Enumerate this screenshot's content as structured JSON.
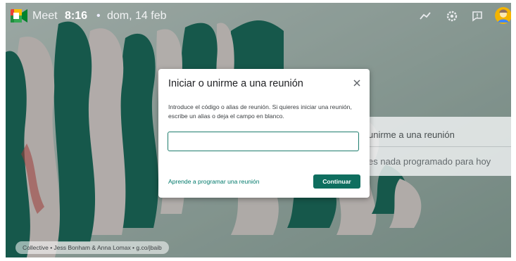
{
  "topbar": {
    "app_name": "Meet",
    "time": "8:16",
    "separator": "•",
    "date": "dom, 14 feb",
    "icons": [
      "activity-chart-icon",
      "settings-gear-icon",
      "feedback-icon",
      "user-avatar"
    ]
  },
  "side_card": {
    "join_text": "unirme a una reunión",
    "empty_text": "es nada programado para hoy"
  },
  "credit": "Collective • Jess Bonham & Anna Lomax • g.co/jbaib",
  "dialog": {
    "title": "Iniciar o unirme a una reunión",
    "description": "Introduce el código o alias de reunión. Si quieres iniciar una reunión, escribe un alias o deja el campo en blanco.",
    "input_value": "",
    "input_placeholder": "",
    "learn_link": "Aprende a programar una reunión",
    "continue_label": "Continuar"
  },
  "colors": {
    "accent": "#0f6e5f",
    "wave_green": "#1f7a68",
    "background": "#b9cec8"
  }
}
